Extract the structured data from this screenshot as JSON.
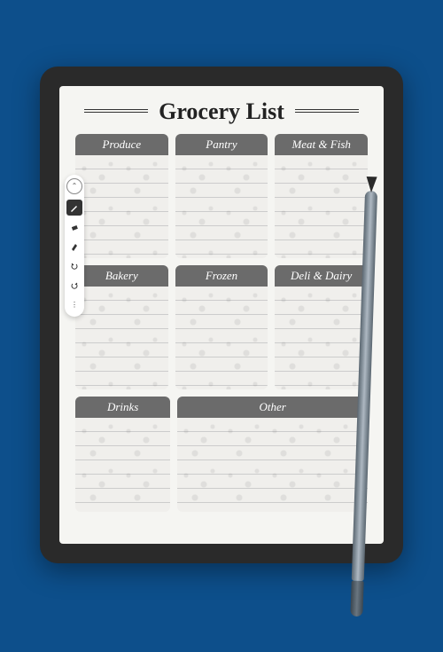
{
  "document": {
    "title": "Grocery List",
    "categories": {
      "row1": [
        {
          "label": "Produce"
        },
        {
          "label": "Pantry"
        },
        {
          "label": "Meat & Fish"
        }
      ],
      "row2": [
        {
          "label": "Bakery"
        },
        {
          "label": "Frozen"
        },
        {
          "label": "Deli & Dairy"
        }
      ],
      "row3": [
        {
          "label": "Drinks"
        },
        {
          "label": "Other"
        }
      ]
    }
  },
  "toolbar": {
    "items": [
      {
        "name": "collapse",
        "glyph": "⌃"
      },
      {
        "name": "pen",
        "active": true
      },
      {
        "name": "eraser",
        "active": false
      },
      {
        "name": "highlighter",
        "active": false
      },
      {
        "name": "undo",
        "active": false
      },
      {
        "name": "redo",
        "active": false
      },
      {
        "name": "more",
        "active": false
      }
    ]
  }
}
